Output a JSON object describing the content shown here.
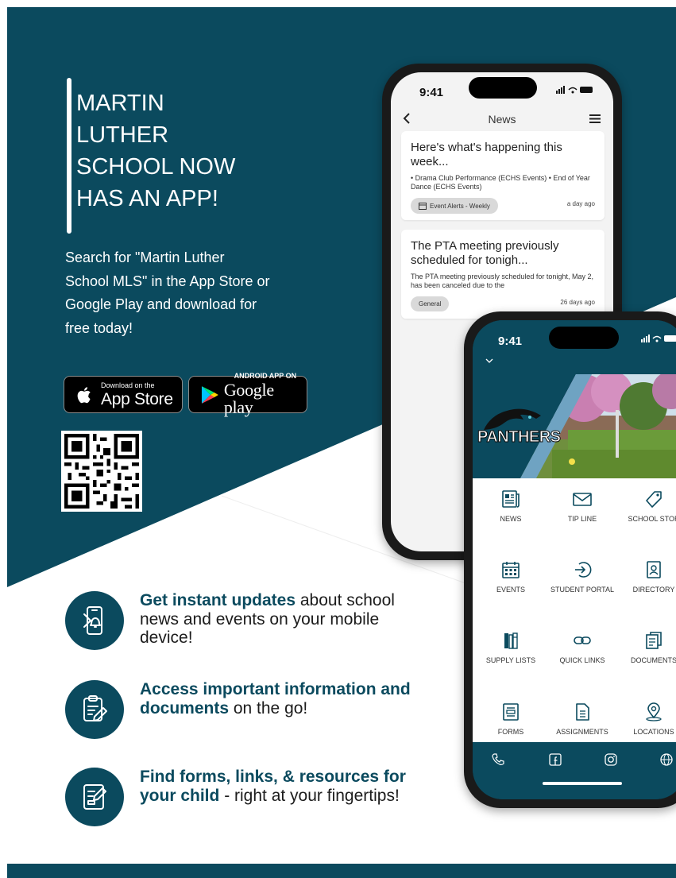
{
  "colors": {
    "brand": "#0b4a5e",
    "white": "#ffffff",
    "text": "#1c1c1c"
  },
  "headline": {
    "lines": [
      "MARTIN",
      "LUTHER",
      "SCHOOL NOW",
      "HAS AN APP!"
    ]
  },
  "subtext": "Search for \"Martin Luther School MLS\" in the App Store or Google Play and download for free today!",
  "badges": {
    "apple": {
      "small": "Download on the",
      "big": "App Store",
      "icon": "apple-icon"
    },
    "google": {
      "small": "ANDROID APP ON",
      "big": "Google play",
      "icon": "google-play-icon"
    }
  },
  "features": [
    {
      "icon": "phone-bell-icon",
      "bold": "Get instant updates",
      "rest": " about school news and events on your mobile device!"
    },
    {
      "icon": "clipboard-pen-icon",
      "bold": "Access important information and documents",
      "rest": " on the go!"
    },
    {
      "icon": "form-edit-icon",
      "bold": "Find forms, links, & resources for your child",
      "rest": " - right at your fingertips!"
    }
  ],
  "phone1": {
    "time": "9:41",
    "nav_title": "News",
    "cards": [
      {
        "title": "Here's what's happening this week...",
        "body": "• Drama Club Performance (ECHS Events) • End of Year Dance (ECHS Events)",
        "tag": "Event Alerts - Weekly",
        "time": "a day ago"
      },
      {
        "title": "The PTA meeting previously scheduled for tonigh...",
        "body": "The PTA meeting previously scheduled for tonight, May 2, has been canceled due to the",
        "tag": "General",
        "time": "26 days ago"
      }
    ]
  },
  "phone2": {
    "time": "9:41",
    "logo_text": "PANTHERS",
    "tiles": [
      {
        "label": "NEWS",
        "icon": "news-icon"
      },
      {
        "label": "TIP LINE",
        "icon": "envelope-icon"
      },
      {
        "label": "SCHOOL STOR",
        "icon": "tag-icon"
      },
      {
        "label": "EVENTS",
        "icon": "calendar-icon"
      },
      {
        "label": "STUDENT PORTAL",
        "icon": "login-arrow-icon"
      },
      {
        "label": "DIRECTORY",
        "icon": "contact-card-icon"
      },
      {
        "label": "SUPPLY LISTS",
        "icon": "books-icon"
      },
      {
        "label": "QUICK LINKS",
        "icon": "link-icon"
      },
      {
        "label": "DOCUMENTS",
        "icon": "documents-icon"
      },
      {
        "label": "FORMS",
        "icon": "form-icon"
      },
      {
        "label": "ASSIGNMENTS",
        "icon": "file-lines-icon"
      },
      {
        "label": "LOCATIONS",
        "icon": "location-pin-icon"
      }
    ],
    "footer_icons": [
      "phone-icon",
      "facebook-icon",
      "instagram-icon",
      "web-icon"
    ]
  }
}
